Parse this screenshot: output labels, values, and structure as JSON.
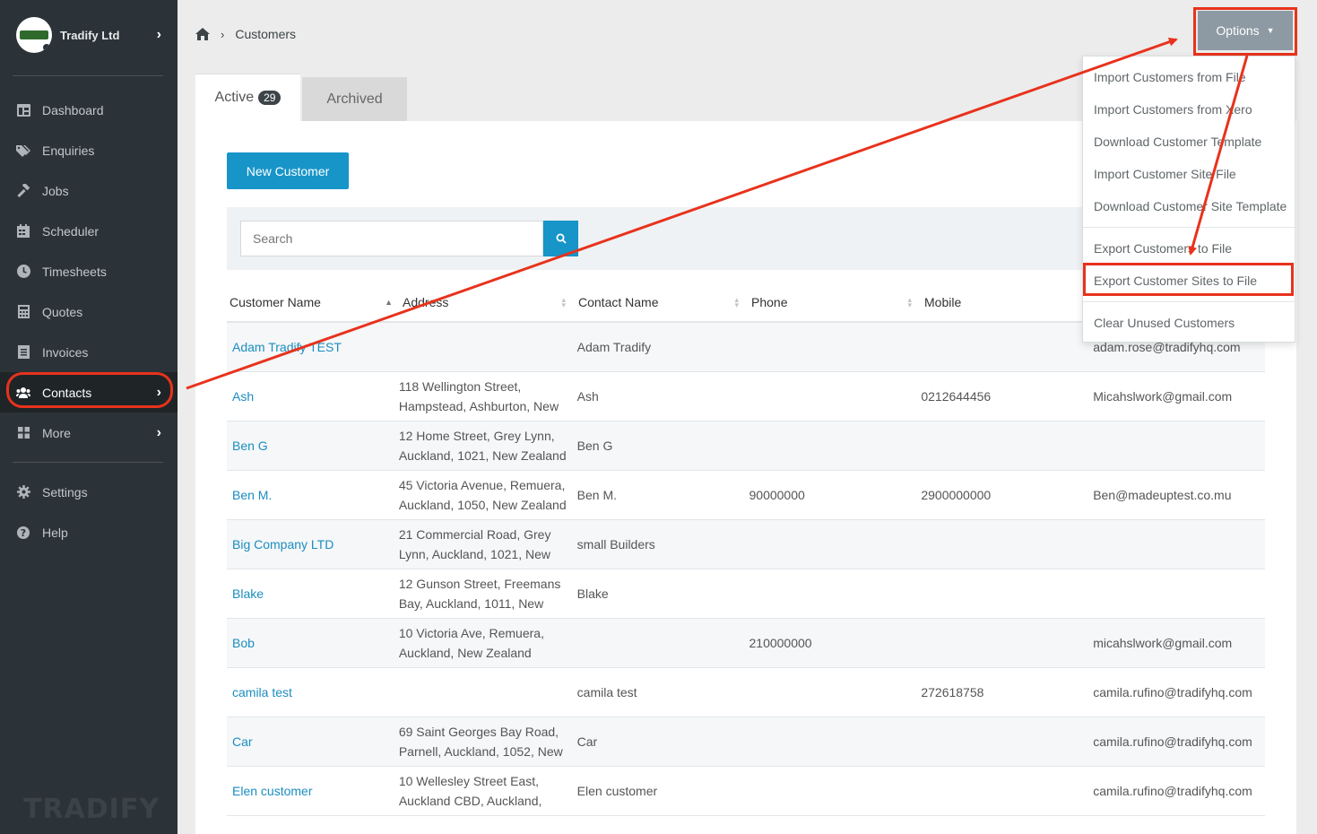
{
  "sidebar": {
    "company": "Tradify Ltd",
    "items": [
      {
        "label": "Dashboard",
        "icon": "dashboard-icon"
      },
      {
        "label": "Enquiries",
        "icon": "tags-icon"
      },
      {
        "label": "Jobs",
        "icon": "hammer-icon"
      },
      {
        "label": "Scheduler",
        "icon": "calendar-icon"
      },
      {
        "label": "Timesheets",
        "icon": "clock-icon"
      },
      {
        "label": "Quotes",
        "icon": "calculator-icon"
      },
      {
        "label": "Invoices",
        "icon": "invoice-icon"
      },
      {
        "label": "Contacts",
        "icon": "users-icon"
      },
      {
        "label": "More",
        "icon": "grid-icon"
      }
    ],
    "bottom_items": [
      {
        "label": "Settings",
        "icon": "gear-icon"
      },
      {
        "label": "Help",
        "icon": "help-icon"
      }
    ],
    "brand": "TRADIFY"
  },
  "breadcrumb": {
    "current": "Customers"
  },
  "tabs": {
    "active_label": "Active",
    "active_count": "29",
    "archived_label": "Archived"
  },
  "toolbar": {
    "new_customer": "New Customer",
    "options": "Options"
  },
  "search": {
    "placeholder": "Search"
  },
  "options_menu": [
    "Import Customers from File",
    "Import Customers from Xero",
    "Download Customer Template",
    "Import Customer Site File",
    "Download Customer Site Template",
    "Export Customers to File",
    "Export Customer Sites to File",
    "Clear Unused Customers"
  ],
  "table": {
    "headers": [
      "Customer Name",
      "Address",
      "Contact Name",
      "Phone",
      "Mobile",
      ""
    ],
    "rows": [
      {
        "name": "Adam Tradify TEST",
        "address1": "",
        "address2": "",
        "contact": "Adam Tradify",
        "phone": "",
        "mobile": "",
        "email": "adam.rose@tradifyhq.com"
      },
      {
        "name": "Ash",
        "address1": "118 Wellington Street,",
        "address2": "Hampstead, Ashburton, New",
        "contact": "Ash",
        "phone": "",
        "mobile": "0212644456",
        "email": "Micahslwork@gmail.com"
      },
      {
        "name": "Ben G",
        "address1": "12 Home Street, Grey Lynn,",
        "address2": "Auckland, 1021, New Zealand",
        "contact": "Ben G",
        "phone": "",
        "mobile": "",
        "email": ""
      },
      {
        "name": "Ben M.",
        "address1": "45 Victoria Avenue, Remuera,",
        "address2": "Auckland, 1050, New Zealand",
        "contact": "Ben M.",
        "phone": "90000000",
        "mobile": "2900000000",
        "email": "Ben@madeuptest.co.mu"
      },
      {
        "name": "Big Company LTD",
        "address1": "21 Commercial Road, Grey",
        "address2": "Lynn, Auckland, 1021, New",
        "contact": "small Builders",
        "phone": "",
        "mobile": "",
        "email": ""
      },
      {
        "name": "Blake",
        "address1": "12 Gunson Street, Freemans",
        "address2": "Bay, Auckland, 1011, New",
        "contact": "Blake",
        "phone": "",
        "mobile": "",
        "email": ""
      },
      {
        "name": "Bob",
        "address1": "10 Victoria Ave, Remuera,",
        "address2": "Auckland, New Zealand",
        "contact": "",
        "phone": "210000000",
        "mobile": "",
        "email": "micahslwork@gmail.com"
      },
      {
        "name": "camila test",
        "address1": "",
        "address2": "",
        "contact": "camila test",
        "phone": "",
        "mobile": "272618758",
        "email": "camila.rufino@tradifyhq.com"
      },
      {
        "name": "Car",
        "address1": "69 Saint Georges Bay Road,",
        "address2": "Parnell, Auckland, 1052, New",
        "contact": "Car",
        "phone": "",
        "mobile": "",
        "email": "camila.rufino@tradifyhq.com"
      },
      {
        "name": "Elen customer",
        "address1": "10 Wellesley Street East,",
        "address2": "Auckland CBD, Auckland,",
        "contact": "Elen customer",
        "phone": "",
        "mobile": "",
        "email": "camila.rufino@tradifyhq.com"
      }
    ]
  },
  "colors": {
    "sidebar": "#2c3338",
    "accent": "#1795c8",
    "link": "#1b8dbf",
    "annotation": "#e8321c",
    "options_button": "#8e9aa3"
  }
}
